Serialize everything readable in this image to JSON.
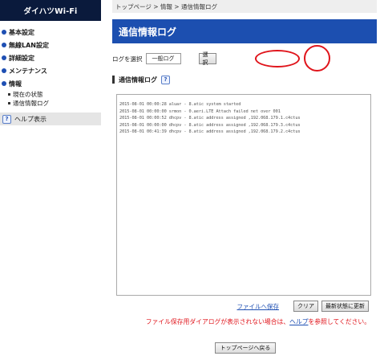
{
  "sidebar": {
    "brand": "ダイハツWi-Fi",
    "items": [
      {
        "label": "基本設定"
      },
      {
        "label": "無線LAN設定"
      },
      {
        "label": "詳細設定"
      },
      {
        "label": "メンテナンス"
      },
      {
        "label": "情報"
      }
    ],
    "sub_items": [
      {
        "label": "現在の状態"
      },
      {
        "label": "通信情報ログ"
      }
    ],
    "help_label": "ヘルプ表示",
    "help_icon": "?"
  },
  "breadcrumb": "トップページ > 情報 > 通信情報ログ",
  "page_title": "通信情報ログ",
  "log_select": {
    "label": "ログを選択",
    "value": "一般ログ",
    "select_button": "選択"
  },
  "section": {
    "title": "通信情報ログ",
    "help_icon": "?"
  },
  "log_lines": "2015-08-01 00:00:28 aluar - 8.atic system started\n2015-08-01 00:00:00 srmon - 0.aeri.LTE Attach failed net over 001\n2015-08-01 00:00:52 dhcpv - 8.atic address assigned ,192.068.179.1.c4ctus\n2015-08-01 00:00:00 dhcpv - 8.atic address assigned ,192.068.179.3.c4ctus\n2015-08-01 00:41:39 dhcpv - 8.atic address assigned ,192.068.179.2.c4ctus",
  "actions": {
    "save_link": "ファイルへ保存",
    "clear_button": "クリア",
    "refresh_button": "最新状態に更新"
  },
  "notice": {
    "before": "ファイル保存用ダイアログが表示されない場合は、",
    "help_link": "ヘルプ",
    "after": "を参照してください。"
  },
  "footer": {
    "back_button": "トップページへ戻る"
  },
  "colors": {
    "brand_bg": "#0a1a3c",
    "title_bar": "#1c4fb0",
    "highlight_oval": "#e0141b",
    "link": "#1e4fb3"
  }
}
